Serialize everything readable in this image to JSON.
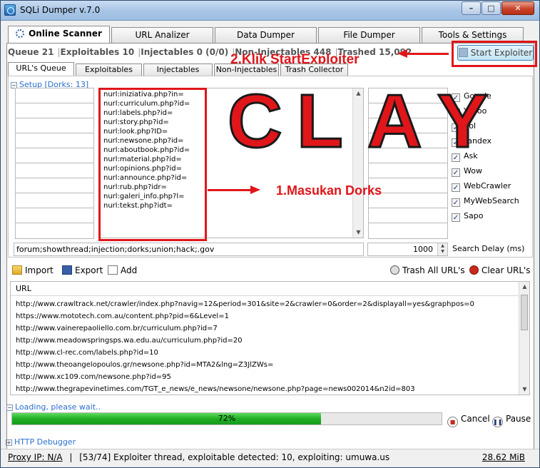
{
  "window": {
    "title": "SQLi Dumper v.7.0",
    "buttons": [
      "–",
      "□",
      "✕"
    ]
  },
  "main_tabs": [
    {
      "label": "Online Scanner",
      "active": true
    },
    {
      "label": "URL Analizer"
    },
    {
      "label": "Data Dumper"
    },
    {
      "label": "File Dumper"
    },
    {
      "label": "Tools & Settings"
    }
  ],
  "stats": {
    "queue": "Queue 21",
    "exploitables": "Exploitables 10",
    "injectables": "Injectables 0 (0/0)",
    "non_injectables": "Non-Injectables 448",
    "trashed": "Trashed 15,092"
  },
  "start_button": "Start Exploiter",
  "sub_tabs": [
    {
      "label": "URL's Queue",
      "active": true
    },
    {
      "label": "Exploitables"
    },
    {
      "label": "Injectables"
    },
    {
      "label": "Non-Injectables"
    },
    {
      "label": "Trash Collector"
    }
  ],
  "setup_label": "Setup [Dorks: 13]",
  "dorks": [
    "nurl:iniziativa.php?in=",
    "nurl:curriculum.php?id=",
    "nurl:labels.php?id=",
    "nurl:story.php?id=",
    "nurl:look.php?ID=",
    "nurl:newsone.php?id=",
    "nurl:aboutbook.php?id=",
    "nurl:material.php?id=",
    "nurl:opinions.php?id=",
    "nurl:announce.php?id=",
    "nurl:rub.php?idr=",
    "nurl:galeri_info.php?l=",
    "nurl:tekst.php?idt="
  ],
  "engines": [
    {
      "label": "Google",
      "checked": true
    },
    {
      "label": "Yahoo",
      "checked": true
    },
    {
      "label": "Aol",
      "checked": true
    },
    {
      "label": "Yandex",
      "checked": true
    },
    {
      "label": "Ask",
      "checked": true
    },
    {
      "label": "Wow",
      "checked": true
    },
    {
      "label": "WebCrawler",
      "checked": true
    },
    {
      "label": "MyWebSearch",
      "checked": true
    },
    {
      "label": "Sapo",
      "checked": true
    }
  ],
  "filter_value": "forum;showthread;injection;dorks;union;hack;.gov",
  "search_delay": {
    "value": "1000",
    "label": "Search Delay (ms)"
  },
  "toolbar": {
    "import": "Import",
    "export": "Export",
    "add": "Add",
    "trash_all": "Trash All URL's",
    "clear": "Clear URL's"
  },
  "list": {
    "header": "URL",
    "urls": [
      "http://www.crawltrack.net/crawler/index.php?navig=12&period=301&site=2&crawler=0&order=2&displayall=yes&graphpos=0",
      "https://www.mototech.com.au/content.php?pid=6&Level=1",
      "http://www.vainerepaoliello.com.br/curriculum.php?id=7",
      "http://www.meadowspringsps.wa.edu.au/curriculum.php?id=20",
      "http://www.cl-rec.com/labels.php?id=10",
      "http://www.theoangelopoulos.gr/newsone.php?id=MTA2&lng=Z3JlZWs=",
      "http://www.xc109.com/newsone.php?id=95",
      "http://www.thegrapevinetimes.com/TGT_e_news/e_news/newsone/newsone.php?page=news002014&n2id=803"
    ]
  },
  "loading": {
    "label": "Loading, please wait..",
    "progress_text": "72%",
    "progress_value": 0.72
  },
  "actions": {
    "cancel": "Cancel",
    "pause": "Pause"
  },
  "http_debugger": "HTTP Debugger",
  "status": {
    "proxy": "Proxy IP: N/A",
    "message": "[53/74] Exploiter thread, exploitable detected: 10, exploiting: umuwa.us",
    "memory": "28.62 MiB"
  },
  "annotations": {
    "step1": "1.Masukan Dorks",
    "step2": "2.Klik StartExploiter",
    "watermark": [
      "C",
      "L",
      "A",
      "Y"
    ]
  },
  "colors": {
    "annotation_red": "#e0161a",
    "link_blue": "#2a6fce",
    "progress_green": "#1fae23"
  }
}
